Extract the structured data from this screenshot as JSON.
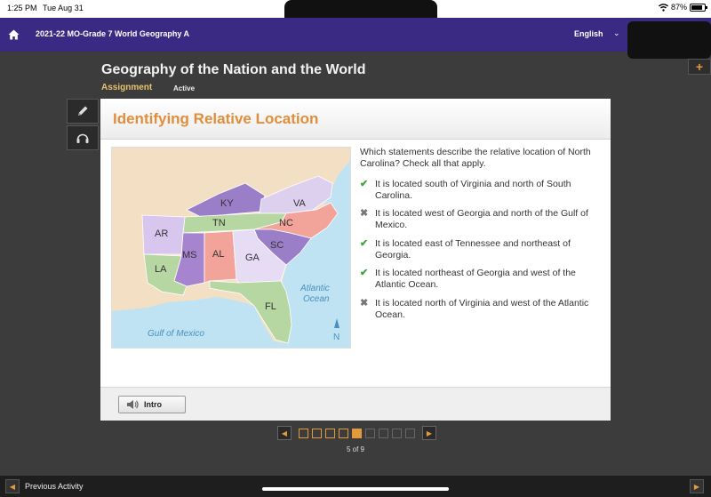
{
  "status_bar": {
    "time": "1:25 PM",
    "date": "Tue Aug 31",
    "battery": "87%",
    "battery_level": 0.87
  },
  "top_bar": {
    "course_title": "2021-22 MO-Grade 7 World Geography A",
    "language": "English"
  },
  "header": {
    "title": "Geography of the Nation and the World",
    "tab_assignment": "Assignment",
    "tab_active": "Active"
  },
  "card": {
    "title": "Identifying Relative Location",
    "question": "Which statements describe the relative location of North Carolina? Check all that apply.",
    "options": [
      {
        "text": "It is located south of Virginia and north of South Carolina.",
        "mark": "check"
      },
      {
        "text": "It is located west of Georgia and north of the Gulf of Mexico.",
        "mark": "cross"
      },
      {
        "text": "It is located east of Tennessee and northeast of Georgia.",
        "mark": "check"
      },
      {
        "text": "It is located northeast of Georgia and west of the Atlantic Ocean.",
        "mark": "check"
      },
      {
        "text": "It is located north of Virginia and west of the Atlantic Ocean.",
        "mark": "cross"
      }
    ],
    "intro_label": "Intro"
  },
  "map": {
    "states": {
      "ky": "KY",
      "va": "VA",
      "tn": "TN",
      "nc": "NC",
      "ar": "AR",
      "sc": "SC",
      "ms": "MS",
      "al": "AL",
      "ga": "GA",
      "la": "LA",
      "fl": "FL"
    },
    "atlantic_1": "Atlantic",
    "atlantic_2": "Ocean",
    "gulf": "Gulf of Mexico",
    "compass": "N"
  },
  "pager": {
    "current": 5,
    "total": 9,
    "label": "5 of 9"
  },
  "bottom_bar": {
    "previous_label": "Previous Activity"
  },
  "colors": {
    "purple_bar": "#3a2a84",
    "accent_orange": "#e08e3c",
    "check_green": "#3aa33a"
  }
}
